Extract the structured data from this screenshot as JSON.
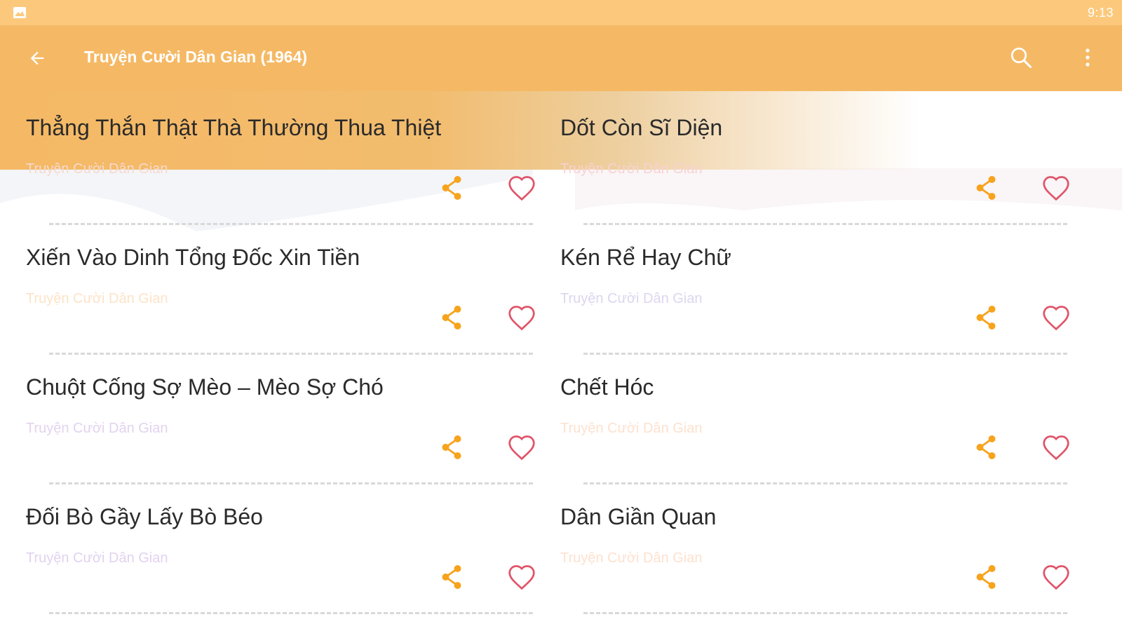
{
  "status_bar": {
    "time": "9:13",
    "left_icon": "image-icon"
  },
  "toolbar": {
    "title": "Truyện Cười Dân Gian (1964)",
    "back_icon": "arrow-back-icon",
    "search_icon": "search-icon",
    "more_icon": "more-vertical-icon",
    "background_color": "#f5b965"
  },
  "colors": {
    "share": "#f7a31c",
    "favorite": "#e0556a",
    "status_bar": "#fcc97c"
  },
  "stories": [
    {
      "title": "Thẳng Thắn Thật Thà Thường Thua Thiệt",
      "subtitle": "Truyện Cười Dân Gian",
      "subtitle_color": "#f6d9d0"
    },
    {
      "title": "Dốt Còn Sĩ Diện",
      "subtitle": "Truyện Cười Dân Gian",
      "subtitle_color": "#f8d2d2"
    },
    {
      "title": "Xiến Vào Dinh Tổng Đốc Xin Tiền",
      "subtitle": "Truyện Cười Dân Gian",
      "subtitle_color": "#fde3c8"
    },
    {
      "title": "Kén Rể Hay Chữ",
      "subtitle": "Truyện Cười Dân Gian",
      "subtitle_color": "#dcd6ee"
    },
    {
      "title": "Chuột Cống Sợ Mèo – Mèo Sợ Chó",
      "subtitle": "Truyện Cười Dân Gian",
      "subtitle_color": "#e3d3ef"
    },
    {
      "title": "Chết Hóc",
      "subtitle": "Truyện Cười Dân Gian",
      "subtitle_color": "#fde1cf"
    },
    {
      "title": "Đối Bò Gầy Lấy Bò Béo",
      "subtitle": "Truyện Cười Dân Gian",
      "subtitle_color": "#e2d2ef"
    },
    {
      "title": "Dân Giần Quan",
      "subtitle": "Truyện Cười Dân Gian",
      "subtitle_color": "#fde1cf"
    }
  ]
}
